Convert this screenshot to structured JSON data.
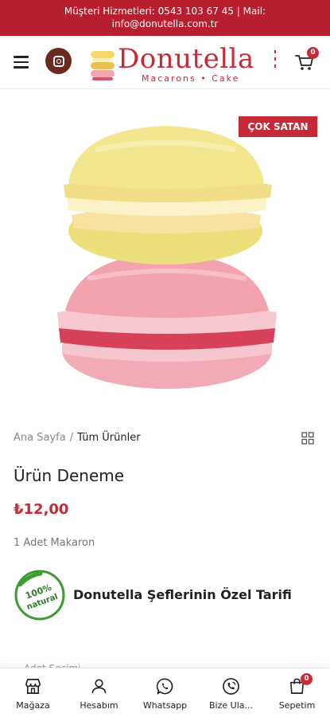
{
  "topbar": {
    "line1": "Müşteri Hizmetleri: 0543 103 67 45  | Mail:",
    "line2": "info@donutella.com.tr"
  },
  "header": {
    "menu_icon": "hamburger-menu-icon",
    "instagram_icon": "instagram-icon",
    "logo": {
      "word": "Donutella",
      "tagline": "Macarons • Cake"
    },
    "cart_icon": "shopping-cart-icon",
    "cart_count": "0"
  },
  "product": {
    "badge": "ÇOK SATAN",
    "breadcrumb": {
      "home": "Ana Sayfa",
      "separator": "/",
      "current": "Tüm Ürünler"
    },
    "title": "Ürün Deneme",
    "price": "₺12,00",
    "short_description": "1 Adet Makaron",
    "feature_text": "Donutella Şeflerinin Özel Tarifi",
    "options_label": "Adet Seçimi"
  },
  "bottom_nav": [
    {
      "label": "Mağaza",
      "icon": "store-icon"
    },
    {
      "label": "Hesabım",
      "icon": "user-icon"
    },
    {
      "label": "Whatsapp",
      "icon": "whatsapp-icon"
    },
    {
      "label": "Bize Ula...",
      "icon": "phone-icon"
    },
    {
      "label": "Sepetim",
      "icon": "shopping-bag-icon",
      "badge": "0"
    }
  ],
  "colors": {
    "brand_red": "#c62a36",
    "topbar_red": "#b81f2e",
    "macaron_yellow": "#f3e68b",
    "macaron_pink": "#f0a5b1"
  }
}
